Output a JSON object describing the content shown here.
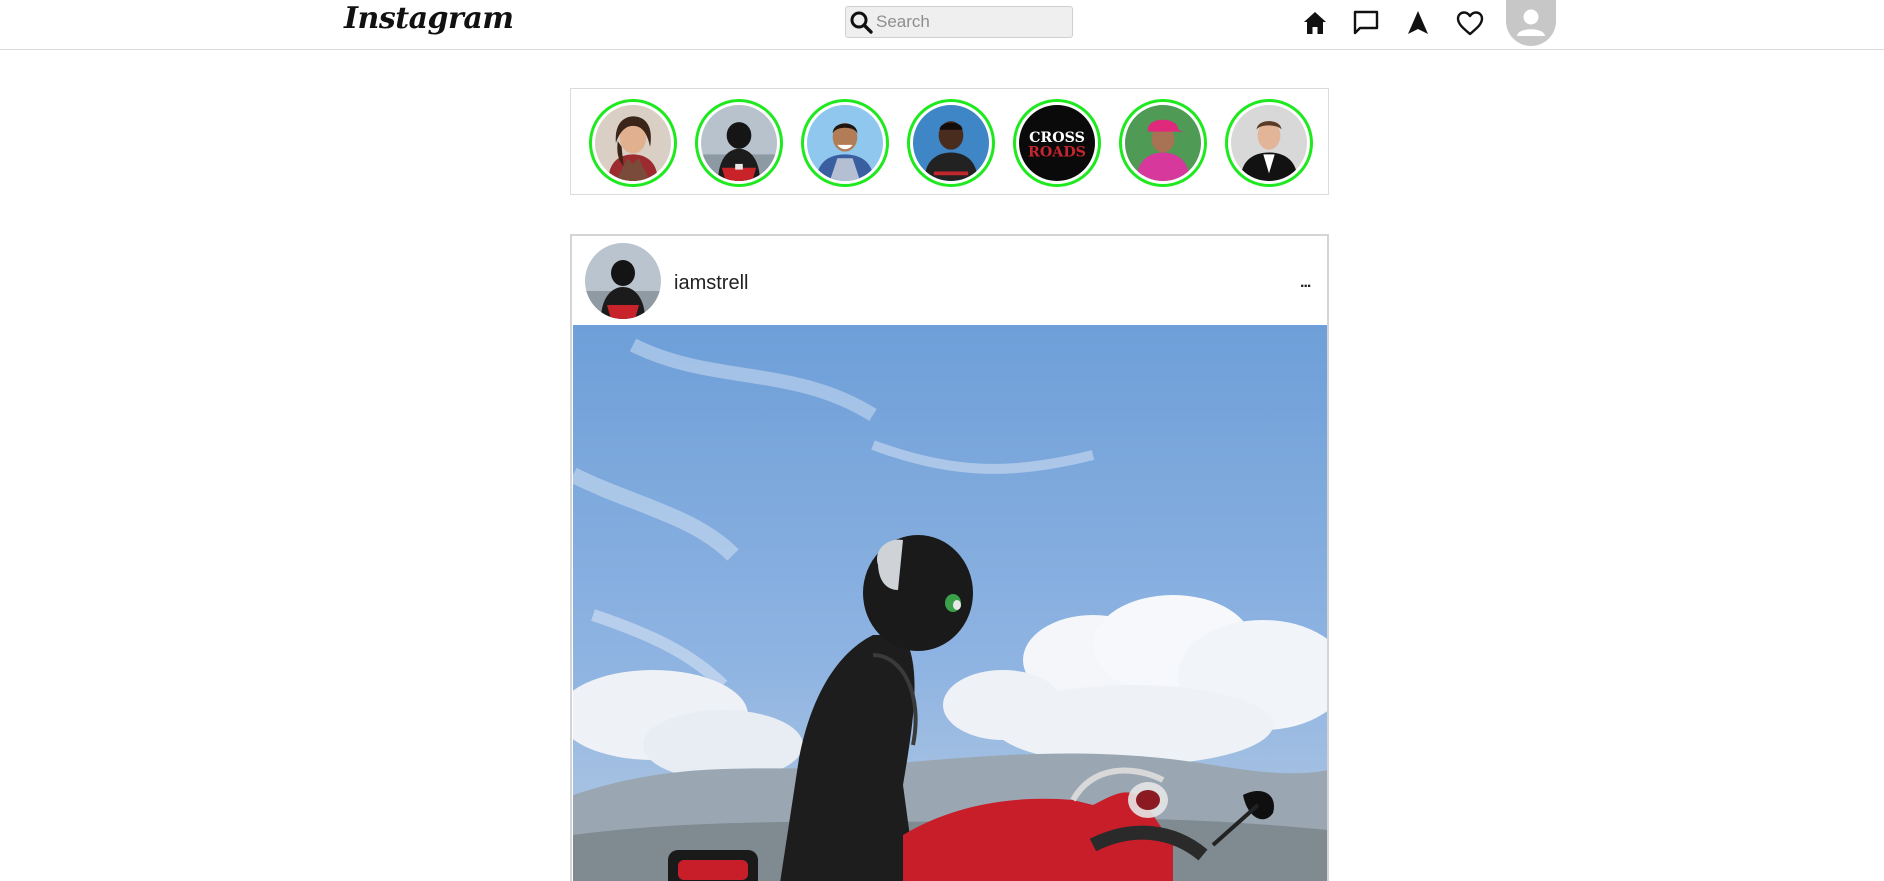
{
  "header": {
    "logo_text": "Instagram",
    "search": {
      "placeholder": "Search",
      "value": ""
    },
    "nav_icons": [
      "home-icon",
      "messages-icon",
      "explore-icon",
      "activity-heart-icon",
      "profile-avatar"
    ]
  },
  "stories": {
    "items": [
      {
        "name": "story-1"
      },
      {
        "name": "story-2"
      },
      {
        "name": "story-3"
      },
      {
        "name": "story-4"
      },
      {
        "name": "story-5",
        "text_line1": "CROSS",
        "text_line2": "ROADS"
      },
      {
        "name": "story-6"
      },
      {
        "name": "story-7"
      }
    ],
    "ring_color": "#1ee81e"
  },
  "post": {
    "username": "iamstrell",
    "more_label": "...",
    "image_subject": "motorcycle-rider-photo"
  },
  "colors": {
    "border": "#dbdbdb",
    "story_ring": "#1ee81e",
    "sky": "#86aee0"
  }
}
